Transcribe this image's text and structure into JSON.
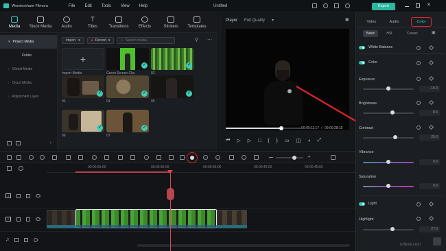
{
  "app": {
    "title": "Wondershare Filmora",
    "project_name": "Untitled",
    "export_label": "Export"
  },
  "menu": [
    "File",
    "Edit",
    "Tools",
    "View",
    "Help"
  ],
  "media_tabs": [
    {
      "label": "Media",
      "icon": "media-icon"
    },
    {
      "label": "Stock Media",
      "icon": "stock-media-icon"
    },
    {
      "label": "Audio",
      "icon": "audio-icon"
    },
    {
      "label": "Titles",
      "icon": "titles-icon"
    },
    {
      "label": "Transitions",
      "icon": "transitions-icon"
    },
    {
      "label": "Effects",
      "icon": "effects-icon"
    },
    {
      "label": "Stickers",
      "icon": "stickers-icon"
    },
    {
      "label": "Templates",
      "icon": "templates-icon"
    }
  ],
  "left_nav": {
    "items": [
      "Project Media",
      "Folder",
      "Global Media",
      "Cloud Media",
      "Adjustment Layer"
    ]
  },
  "media": {
    "import_label": "Import",
    "record_label": "Record",
    "search_placeholder": "Search media",
    "import_media_label": "Import Media",
    "clips": [
      {
        "label": "Green Screen Clip"
      },
      {
        "label": "02"
      },
      {
        "label": "03"
      },
      {
        "label": "04"
      },
      {
        "label": "05"
      },
      {
        "label": "06"
      },
      {
        "label": "07"
      }
    ]
  },
  "player": {
    "label": "Player",
    "quality": "Full Quality",
    "current_time": "00:00:11:17",
    "total_time": "00:00:28:15"
  },
  "right_panel": {
    "tabs": [
      "Video",
      "Audio",
      "Color"
    ],
    "subtabs": [
      "Basic",
      "HSL",
      "Curves"
    ],
    "sections": {
      "white_balance": "White Balance",
      "color": "Color",
      "light": "Light"
    },
    "sliders": [
      {
        "label": "Exposure",
        "value": "-10.0"
      },
      {
        "label": "Brightness",
        "value": "8.5"
      },
      {
        "label": "Contrast",
        "value": "25.0"
      },
      {
        "label": "Vibrance",
        "value": "0.0"
      },
      {
        "label": "Saturation",
        "value": "0.0"
      },
      {
        "label": "Highlight",
        "value": "27.5"
      }
    ]
  },
  "timeline": {
    "ruler": [
      "00:00:25:00",
      "00:00:30:00",
      "00:00:35:00",
      "00:00:40:00",
      "00:00:45:00"
    ],
    "track_numbers": [
      "3",
      "2",
      "1"
    ]
  },
  "colors": {
    "accent": "#37d0b9",
    "playhead": "#e0474c",
    "annotation_red": "#e1242a"
  },
  "watermark": "orfeviv.com"
}
